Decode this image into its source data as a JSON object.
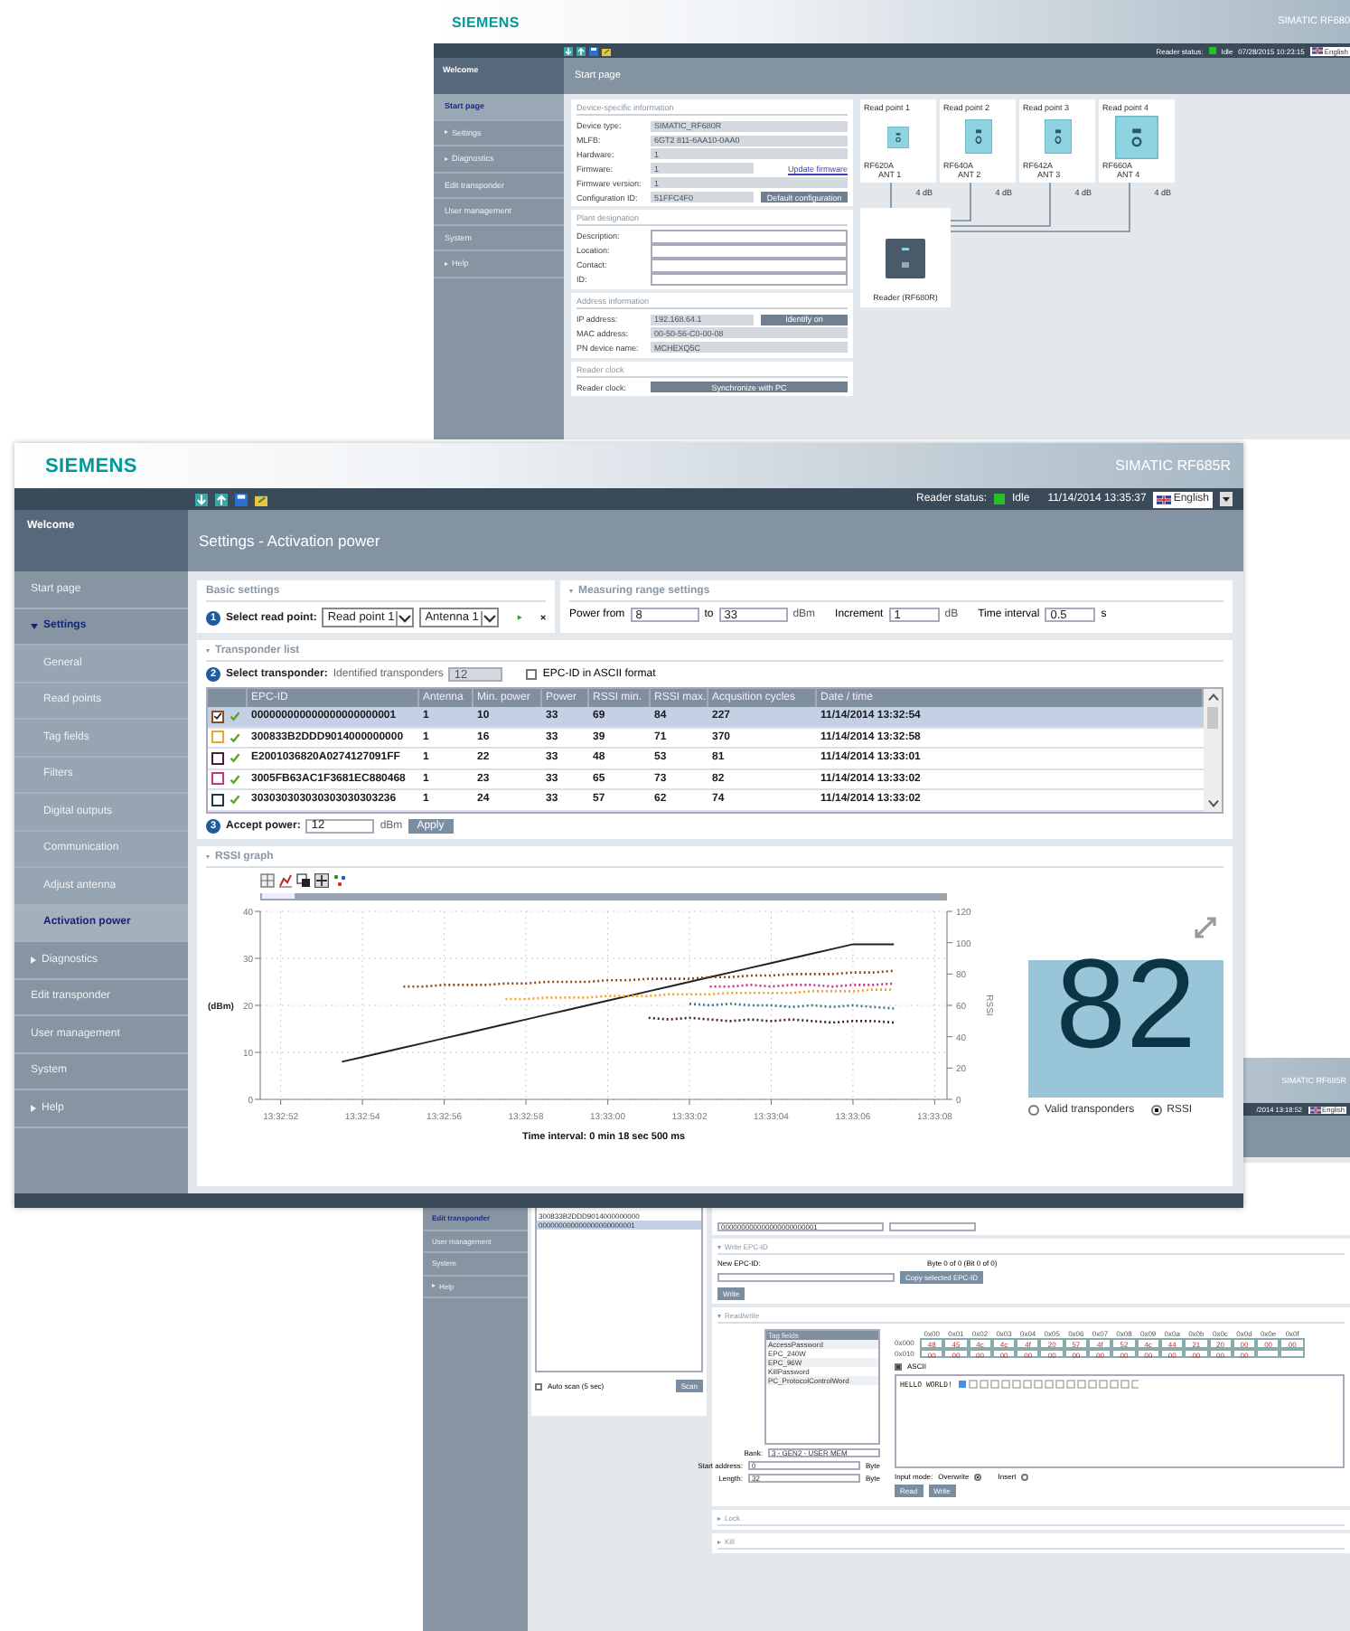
{
  "back_window": {
    "brand": "SIEMENS",
    "product": "SIMATIC RF680",
    "status_label": "Reader status:",
    "status": "Idle",
    "datetime": "07/28/2015 10:23:15",
    "language": "English",
    "sidebar": {
      "title": "Welcome",
      "items": [
        {
          "label": "Start page",
          "selected": true
        },
        {
          "label": "Settings",
          "selected": false,
          "expanded": false
        },
        {
          "label": "Diagnostics",
          "selected": false,
          "expanded": false
        },
        {
          "label": "Edit transponder",
          "selected": false
        },
        {
          "label": "User management",
          "selected": false
        },
        {
          "label": "System",
          "selected": false
        },
        {
          "label": "Help",
          "selected": false,
          "expanded": false
        }
      ]
    },
    "page_title": "Start page",
    "sections": [
      {
        "title": "Device-specific information",
        "rows": [
          {
            "kind": "readonly",
            "label": "Device type:",
            "value": "SIMATIC_RF680R"
          },
          {
            "kind": "readonly",
            "label": "MLFB:",
            "value": "6GT2 811-6AA10-0AA0"
          },
          {
            "kind": "readonly",
            "label": "Hardware:",
            "value": "1"
          },
          {
            "kind": "readonly",
            "label": "Firmware:",
            "value": "1",
            "action": {
              "kind": "link",
              "label": "Update firmware"
            }
          },
          {
            "kind": "readonly",
            "label": "Firmware version:",
            "value": "1"
          },
          {
            "kind": "readonly",
            "label": "Configuration ID:",
            "value": "51FFC4F0",
            "action": {
              "kind": "button",
              "label": "Default configuration"
            }
          }
        ]
      },
      {
        "title": "Plant designation",
        "rows": [
          {
            "kind": "input",
            "label": "Description:"
          },
          {
            "kind": "input",
            "label": "Location:"
          },
          {
            "kind": "input",
            "label": "Contact:"
          },
          {
            "kind": "input",
            "label": "ID:"
          }
        ]
      },
      {
        "title": "Address information",
        "rows": [
          {
            "kind": "readonly",
            "label": "IP address:",
            "value": "192.168.64.1",
            "action": {
              "kind": "button",
              "label": "Identify on"
            }
          },
          {
            "kind": "readonly",
            "label": "MAC address:",
            "value": "00-50-56-C0-00-08"
          },
          {
            "kind": "readonly",
            "label": "PN device name:",
            "value": "MCHEXQ5C"
          }
        ]
      },
      {
        "title": "Reader clock",
        "rows": [
          {
            "kind": "button",
            "label": "Reader clock:",
            "action": {
              "kind": "button",
              "label": "Synchronize with PC"
            }
          }
        ]
      }
    ],
    "read_points": [
      {
        "title": "Read point 1",
        "antenna": "RF620A",
        "port": "ANT 1",
        "gain": "4 dB"
      },
      {
        "title": "Read point 2",
        "antenna": "RF640A",
        "port": "ANT 2",
        "gain": "4 dB"
      },
      {
        "title": "Read point 3",
        "antenna": "RF642A",
        "port": "ANT 3",
        "gain": "4 dB"
      },
      {
        "title": "Read point 4",
        "antenna": "RF660A",
        "port": "ANT 4",
        "gain": "4 dB"
      }
    ],
    "reader": "Reader (RF680R)"
  },
  "main_window": {
    "brand": "SIEMENS",
    "product": "SIMATIC RF685R",
    "status_label": "Reader status:",
    "status": "Idle",
    "datetime": "11/14/2014 13:35:37",
    "language": "English",
    "sidebar": {
      "title": "Welcome",
      "items": [
        {
          "label": "Start page",
          "selected": false
        },
        {
          "label": "Settings",
          "selected": false,
          "expanded": true,
          "children": [
            {
              "label": "General",
              "selected": false
            },
            {
              "label": "Read points",
              "selected": false
            },
            {
              "label": "Tag fields",
              "selected": false
            },
            {
              "label": "Filters",
              "selected": false
            },
            {
              "label": "Digital outputs",
              "selected": false
            },
            {
              "label": "Communication",
              "selected": false
            },
            {
              "label": "Adjust antenna",
              "selected": false
            },
            {
              "label": "Activation power",
              "selected": true
            }
          ]
        },
        {
          "label": "Diagnostics",
          "selected": false,
          "expanded": false
        },
        {
          "label": "Edit transponder",
          "selected": false
        },
        {
          "label": "User management",
          "selected": false
        },
        {
          "label": "System",
          "selected": false
        },
        {
          "label": "Help",
          "selected": false,
          "expanded": false
        }
      ]
    },
    "page_title": "Settings - Activation power",
    "basic_settings": {
      "title": "Basic settings",
      "step": "1",
      "label": "Select read point:",
      "read_point": "Read point 1",
      "antenna": "Antenna 1"
    },
    "measuring": {
      "title": "Measuring range settings",
      "expanded": true,
      "from_label": "Power from",
      "from": "8",
      "to_label": "to",
      "to": "33",
      "to_unit": "dBm",
      "increment_label": "Increment",
      "increment": "1",
      "increment_unit": "dB",
      "interval_label": "Time interval",
      "interval": "0.5",
      "interval_unit": "s"
    },
    "transponders": {
      "title": "Transponder list",
      "expanded": true,
      "step": "2",
      "label": "Select transponder:",
      "count_label": "Identified transponders",
      "count": "12",
      "ascii": {
        "label": "EPC-ID in ASCII format",
        "checked": false
      },
      "columns": [
        "EPC-ID",
        "Antenna",
        "Min. power",
        "Power",
        "RSSI min.",
        "RSSI max.",
        "Acqusition cycles",
        "Date / time"
      ],
      "rows": [
        {
          "color": "#8b4a22",
          "checked": true,
          "selected": true,
          "cells": [
            "000000000000000000000001",
            "1",
            "10",
            "33",
            "69",
            "84",
            "227",
            "11/14/2014 13:32:54"
          ]
        },
        {
          "color": "#f0a428",
          "checked": false,
          "selected": false,
          "cells": [
            "300833B2DDD9014000000000",
            "1",
            "16",
            "33",
            "39",
            "71",
            "370",
            "11/14/2014 13:32:58"
          ]
        },
        {
          "color": "#4a1c3c",
          "checked": false,
          "selected": false,
          "cells": [
            "E2001036820A0274127091FF",
            "1",
            "22",
            "33",
            "48",
            "53",
            "81",
            "11/14/2014 13:33:01"
          ]
        },
        {
          "color": "#c8327e",
          "checked": false,
          "selected": false,
          "cells": [
            "3005FB63AC1F3681EC880468",
            "1",
            "23",
            "33",
            "65",
            "73",
            "82",
            "11/14/2014 13:33:02"
          ]
        },
        {
          "color": "#1e3a4a",
          "checked": false,
          "selected": false,
          "cells": [
            "303030303030303030303236",
            "1",
            "24",
            "33",
            "57",
            "62",
            "74",
            "11/14/2014 13:33:02"
          ]
        }
      ],
      "accept": {
        "step": "3",
        "label": "Accept power:",
        "value": "12",
        "unit": "dBm",
        "button": "Apply"
      }
    },
    "rssi": {
      "title": "RSSI graph",
      "expanded": true,
      "chart_data": {
        "type": "line",
        "grid": true,
        "ylabel": "(dBm)",
        "y2label": "RSSI",
        "xlim": [
          48771.5,
          48788.3
        ],
        "ylim": [
          0,
          40
        ],
        "y2lim": [
          0,
          120
        ],
        "yticks": [
          0,
          10,
          20,
          30,
          40
        ],
        "y2ticks": [
          0,
          20,
          40,
          60,
          80,
          100,
          120
        ],
        "xticks": [
          {
            "value": 48772,
            "label": "13:32:52"
          },
          {
            "value": 48774,
            "label": "13:32:54"
          },
          {
            "value": 48776,
            "label": "13:32:56"
          },
          {
            "value": 48778,
            "label": "13:32:58"
          },
          {
            "value": 48780,
            "label": "13:33:00"
          },
          {
            "value": 48782,
            "label": "13:33:02"
          },
          {
            "value": 48784,
            "label": "13:33:04"
          },
          {
            "value": 48786,
            "label": "13:33:06"
          },
          {
            "value": 48788,
            "label": "13:33:08"
          }
        ],
        "x": [
          48773.5,
          48774,
          48774.5,
          48775,
          48775.5,
          48776,
          48776.5,
          48777,
          48777.5,
          48778,
          48778.5,
          48779,
          48779.5,
          48780,
          48780.5,
          48781,
          48781.5,
          48782,
          48782.5,
          48783,
          48783.5,
          48784,
          48784.5,
          48785,
          48785.5,
          48786,
          48786.5,
          48787
        ],
        "series": [
          {
            "color": "#222222",
            "values": [
              8,
              9,
              10,
              11,
              12,
              13,
              14,
              15,
              16,
              17,
              18,
              19,
              20,
              21,
              22,
              23,
              24,
              25,
              26,
              27,
              28,
              29,
              30,
              31,
              32,
              33,
              33,
              33
            ]
          },
          {
            "color": "#8b4a22",
            "axis": "y2",
            "line_style": "dotted",
            "values": [
              null,
              null,
              null,
              72,
              72,
              73,
              73,
              73,
              74,
              74,
              75,
              75,
              75,
              76,
              76,
              77,
              77,
              77,
              78,
              78,
              79,
              79,
              80,
              80,
              80,
              81,
              81,
              82
            ]
          },
          {
            "color": "#f0a428",
            "axis": "y2",
            "line_style": "dotted",
            "values": [
              null,
              null,
              null,
              null,
              null,
              null,
              null,
              null,
              64,
              64,
              65,
              65,
              65,
              66,
              66,
              66,
              67,
              67,
              67,
              68,
              68,
              68,
              68,
              69,
              69,
              69,
              70,
              70
            ]
          },
          {
            "color": "#4a1c3c",
            "axis": "y2",
            "line_style": "dotted",
            "values": [
              null,
              null,
              null,
              null,
              null,
              null,
              null,
              null,
              null,
              null,
              null,
              null,
              null,
              null,
              null,
              52,
              51,
              52,
              51,
              50,
              51,
              50,
              51,
              50,
              49,
              50,
              50,
              49
            ]
          },
          {
            "color": "#3c7890",
            "axis": "y2",
            "line_style": "dotted",
            "values": [
              null,
              null,
              null,
              null,
              null,
              null,
              null,
              null,
              null,
              null,
              null,
              null,
              null,
              null,
              null,
              null,
              null,
              61,
              60,
              61,
              60,
              60,
              59,
              60,
              59,
              60,
              59,
              58
            ]
          },
          {
            "color": "#c8327e",
            "axis": "y2",
            "line_style": "dotted",
            "values": [
              null,
              null,
              null,
              null,
              null,
              null,
              null,
              null,
              null,
              null,
              null,
              null,
              null,
              null,
              null,
              null,
              null,
              null,
              72,
              72,
              73,
              72,
              73,
              73,
              72,
              73,
              73,
              74
            ]
          }
        ]
      },
      "time_interval": "Time interval: 0 min 18 sec 500 ms",
      "value": "82",
      "modes": [
        {
          "label": "Valid transponders",
          "selected": false
        },
        {
          "label": "RSSI",
          "selected": true
        }
      ]
    }
  },
  "lower_window": {
    "product": "SIMATIC RF685R",
    "datetime": "/2014 13:18:52",
    "language": "English",
    "sidebar": [
      {
        "label": "Edit transponder",
        "selected": true
      },
      {
        "label": "User management",
        "selected": false
      },
      {
        "label": "System",
        "selected": false
      },
      {
        "label": "Help",
        "selected": false,
        "expanded": false
      }
    ],
    "epc_list": [
      {
        "label": "300833B2DDD9014000000000",
        "selected": false
      },
      {
        "label": "000000000000000000000001",
        "selected": true
      }
    ],
    "auto_scan": {
      "label": "Auto scan (5 sec)",
      "checked": false
    },
    "scan_button": "Scan",
    "selected_epc": "000000000000000000000001",
    "write_epc": {
      "title": "Write EPC-ID",
      "expanded": true,
      "new_label": "New EPC-ID:",
      "byte_info": "Byte 0 of 0 (Bit 0 of 0)",
      "copy_button": "Copy selected EPC-ID",
      "write_button": "Write"
    },
    "read_write": {
      "title": "Read/write",
      "expanded": true,
      "fields_header": "Tag fields",
      "fields": [
        {
          "label": "AccessPassword",
          "selected": false
        },
        {
          "label": "EPC_240W",
          "selected": false
        },
        {
          "label": "EPC_96W",
          "selected": false
        },
        {
          "label": "KillPassword",
          "selected": false
        },
        {
          "label": "PC_ProtocolControlWord",
          "selected": false
        }
      ],
      "bank_label": "Bank:",
      "bank": "3 - GEN2 - USER MEM",
      "start_label": "Start address:",
      "start": "0",
      "start_unit": "Byte",
      "length_label": "Length:",
      "length": "32",
      "length_unit": "Byte",
      "columns": [
        "0x00",
        "0x01",
        "0x02",
        "0x03",
        "0x04",
        "0x05",
        "0x06",
        "0x07",
        "0x08",
        "0x09",
        "0x0a",
        "0x0b",
        "0x0c",
        "0x0d",
        "0x0e",
        "0x0f"
      ],
      "rows": [
        {
          "address": "0x000",
          "bytes": [
            "48",
            "45",
            "4c",
            "4c",
            "4f",
            "20",
            "57",
            "4f",
            "52",
            "4c",
            "44",
            "21",
            "20",
            "00",
            "00",
            "00"
          ]
        },
        {
          "address": "0x010",
          "bytes": [
            "00",
            "00",
            "00",
            "00",
            "00",
            "00",
            "00",
            "00",
            "00",
            "00",
            "00",
            "00",
            "00",
            "00"
          ]
        }
      ],
      "ascii": {
        "label": "ASCII",
        "checked": true
      },
      "text": "HELLO WORLD!",
      "input_mode_label": "Input mode:",
      "modes": [
        {
          "label": "Overwrite",
          "selected": true
        },
        {
          "label": "Insert",
          "selected": false
        }
      ],
      "buttons": [
        "Read",
        "Write"
      ]
    },
    "sections": [
      {
        "title": "Lock",
        "expanded": false
      },
      {
        "title": "Kill",
        "expanded": false
      }
    ]
  }
}
